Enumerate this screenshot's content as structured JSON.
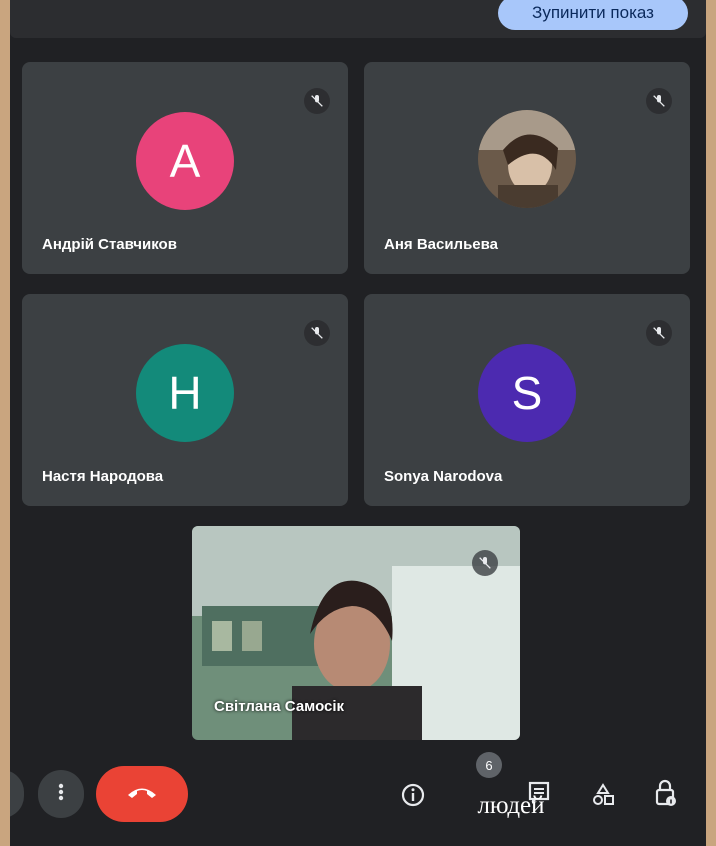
{
  "top": {
    "stop_label": "Зупинити показ"
  },
  "participants": [
    {
      "name": "Андрій Ставчиков",
      "initial": "A",
      "color": "#e8437a"
    },
    {
      "name": "Аня Васильева",
      "initial": "",
      "color": ""
    },
    {
      "name": "Настя Народова",
      "initial": "H",
      "color": "#138a7a"
    },
    {
      "name": "Sonya Narodova",
      "initial": "S",
      "color": "#4c2ab0"
    },
    {
      "name": "Світлана Самосік"
    }
  ],
  "controls": {
    "people_count": "6",
    "people_text": "людей"
  },
  "icons": [
    "mic-off-icon",
    "more-vert-icon",
    "call-end-icon",
    "info-icon",
    "people-icon",
    "activities-icon",
    "host-controls-icon"
  ],
  "colors": {
    "end_call": "#ea4335",
    "accent": "#a8c7fa",
    "tile": "#3c4043",
    "background": "#202124"
  }
}
